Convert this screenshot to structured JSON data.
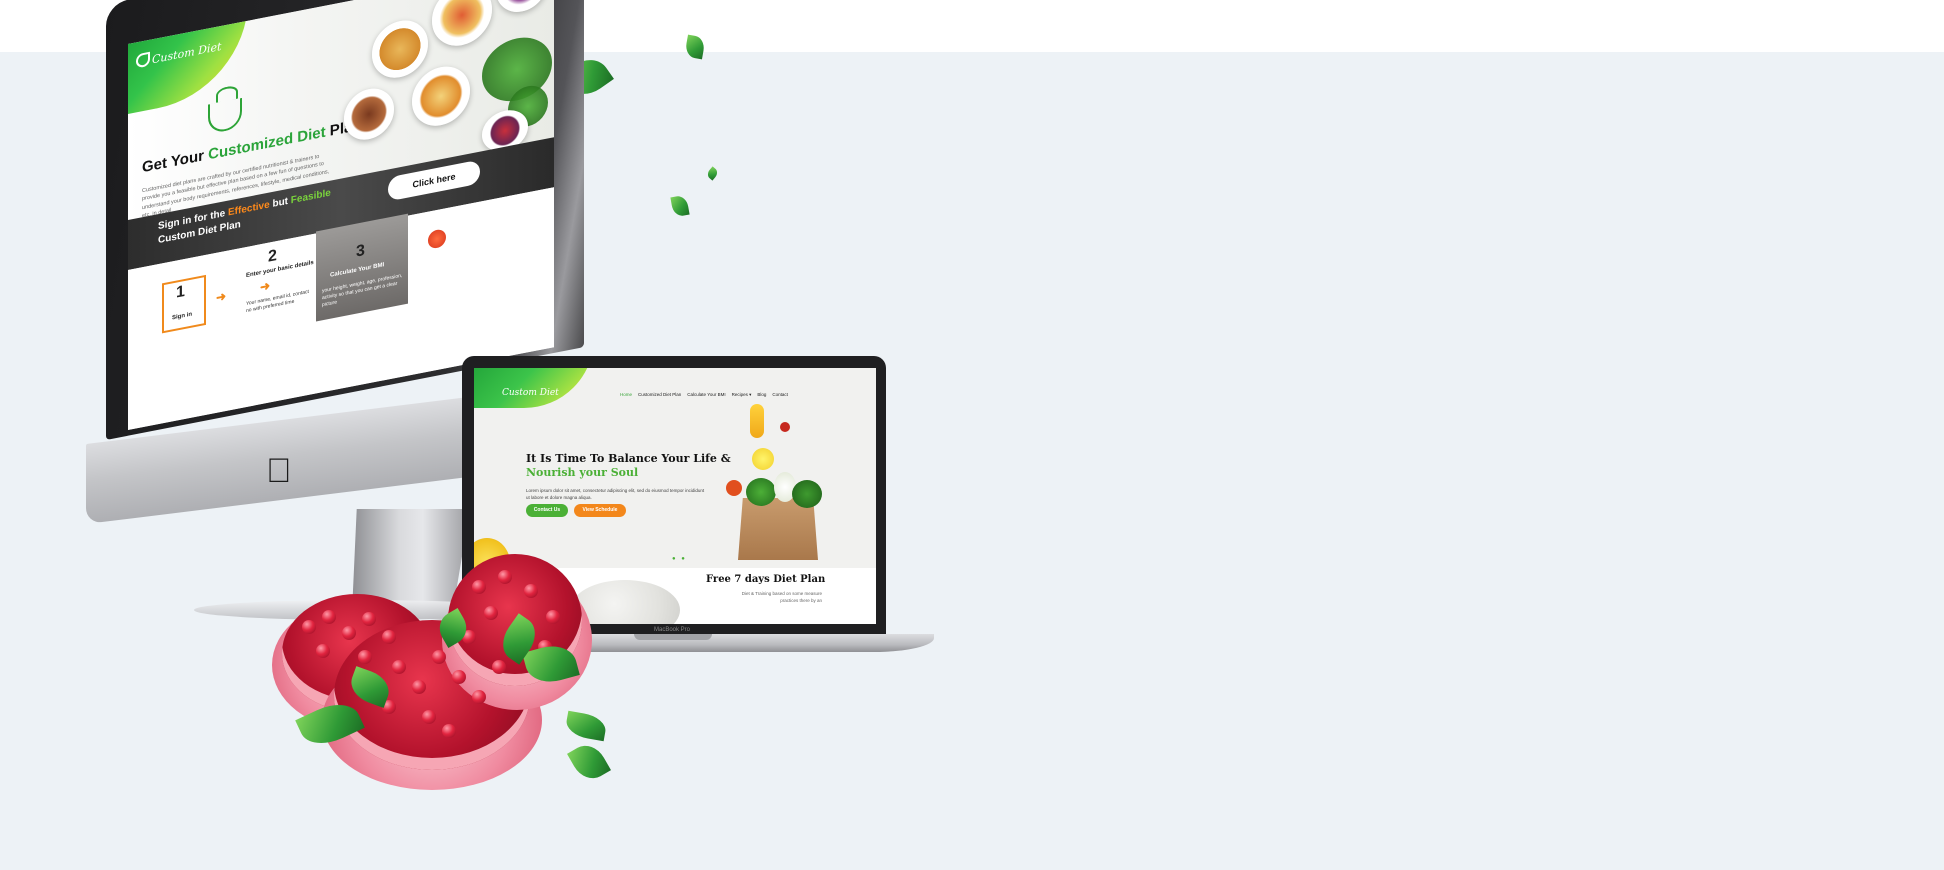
{
  "imac": {
    "logo": "Custom Diet",
    "hero_title_prefix": "Get Your ",
    "hero_title_highlight": "Customized Diet",
    "hero_title_suffix": " Plan",
    "hero_description": "Customized diet plans are crafted by our certified nutritionist & trainers to provide you a feasible but effective plan based on a few fun of questions to understand your body requirements, references, lifestyle, medical conditions, etc. in detail",
    "band_line1_prefix": "Sign in for the ",
    "band_line1_orange": "Effective",
    "band_line1_mid": " but ",
    "band_line1_green": "Feasible",
    "band_line2": "Custom Diet Plan",
    "click_button": "Click here",
    "step1_number": "1",
    "step1_label": "Sign in",
    "step2_number": "2",
    "step2_label": "Enter your basic details",
    "step2_text": "Your name, email id, contact no with preferred time",
    "step3_number": "3",
    "step3_label": "Calculate Your BMI",
    "step3_text": "your height, weight, age, profession, activity so that you can get a clear picture"
  },
  "macbook": {
    "logo": "Custom Diet",
    "nav": [
      "Home",
      "Customized Diet Plan",
      "Calculate Your BMI",
      "Recipes ▾",
      "Blog",
      "Contact"
    ],
    "headline_line1": "It Is Time To  Balance Your Life &",
    "headline_line2": "Nourish your Soul",
    "paragraph": "Lorem ipsum dolor sit amet, consectetur adipiscing elit, sed do eiusmod tempor incididunt ut labore et dolore magna aliqua.",
    "btn_contact": "Contact Us",
    "btn_schedule": "View Schedule",
    "plan_title": "Free 7 days Diet Plan",
    "plan_subtitle": "Diet & Training based on some measure practices there by an",
    "device_label": "MacBook Pro",
    "slider_dots": "● ●"
  },
  "colors": {
    "background": "#edf2f6",
    "brand_green": "#2ba43a",
    "accent_orange": "#f08a1c",
    "btn_contact": "#4bb036",
    "btn_schedule": "#f3871b"
  }
}
